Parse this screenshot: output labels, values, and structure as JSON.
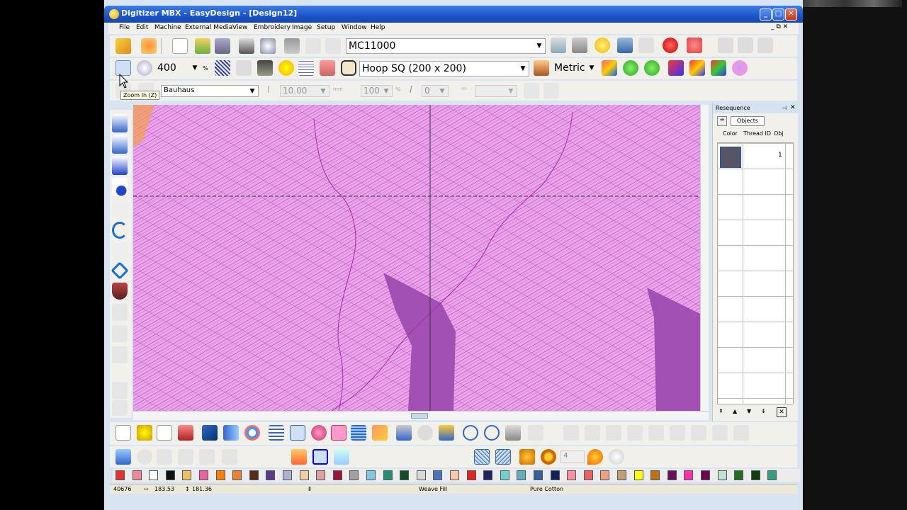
{
  "window": {
    "title": "Digitizer MBX - EasyDesign - [Design12]",
    "min_glyph": "_",
    "max_glyph": "□",
    "close_glyph": "✕",
    "mdi_controls": "_ ⧉ ✕"
  },
  "menu": [
    "File",
    "Edit",
    "Machine",
    "External Media",
    "View",
    "Embroidery",
    "Image",
    "Setup",
    "Window",
    "Help"
  ],
  "toolbar1": {
    "machine": "MC11000"
  },
  "toolbar2": {
    "zoom_value": "400",
    "zoom_unit": "%",
    "hoop": "Hoop SQ (200 x 200)",
    "units": "Metric"
  },
  "toolbar3": {
    "font": "Bauhaus",
    "height_value": "10.00",
    "height_unit": "mm",
    "width_value": "100",
    "width_unit": "%",
    "italic_label": "I",
    "italic_value": "0",
    "abc_value": ""
  },
  "tooltip": "Zoom In (Z)",
  "resequence": {
    "title": "Resequence",
    "tab_objects": "Objects",
    "col_color": "Color",
    "col_thread": "Thread ID",
    "col_obj": "Obj",
    "rows": [
      {
        "color": "#555566",
        "thread": "",
        "obj": "1"
      }
    ]
  },
  "bottom_toolbar": {
    "stitch_count_field": "4"
  },
  "palette": [
    "#e83030",
    "#ee8899",
    "#ffffff",
    "#111111",
    "#f0c060",
    "#f060a0",
    "#ff7f00",
    "#f08030",
    "#5a2a10",
    "#5a3a8a",
    "#b0b0d0",
    "#f0d0a0",
    "#e0a0a0",
    "#a01040",
    "#a0a0a0",
    "#80c8e0",
    "#209070",
    "#105028",
    "#d8d8d8",
    "#4a74c0",
    "#f8c8a8",
    "#e82020",
    "#202060",
    "#70d0d0",
    "#60b0c0",
    "#3060a0",
    "#102060",
    "#ff90a0",
    "#f06060",
    "#f0a080",
    "#c0a070",
    "#ffff00",
    "#c07010",
    "#6a1060",
    "#ff30b0",
    "#700050",
    "#c0e0d0",
    "#207020",
    "#104010",
    "#30a080"
  ],
  "status": {
    "stitches": "40676",
    "width": "183.53",
    "height": "181.36",
    "fill": "Weave Fill",
    "thread": "Pure Cotton"
  }
}
